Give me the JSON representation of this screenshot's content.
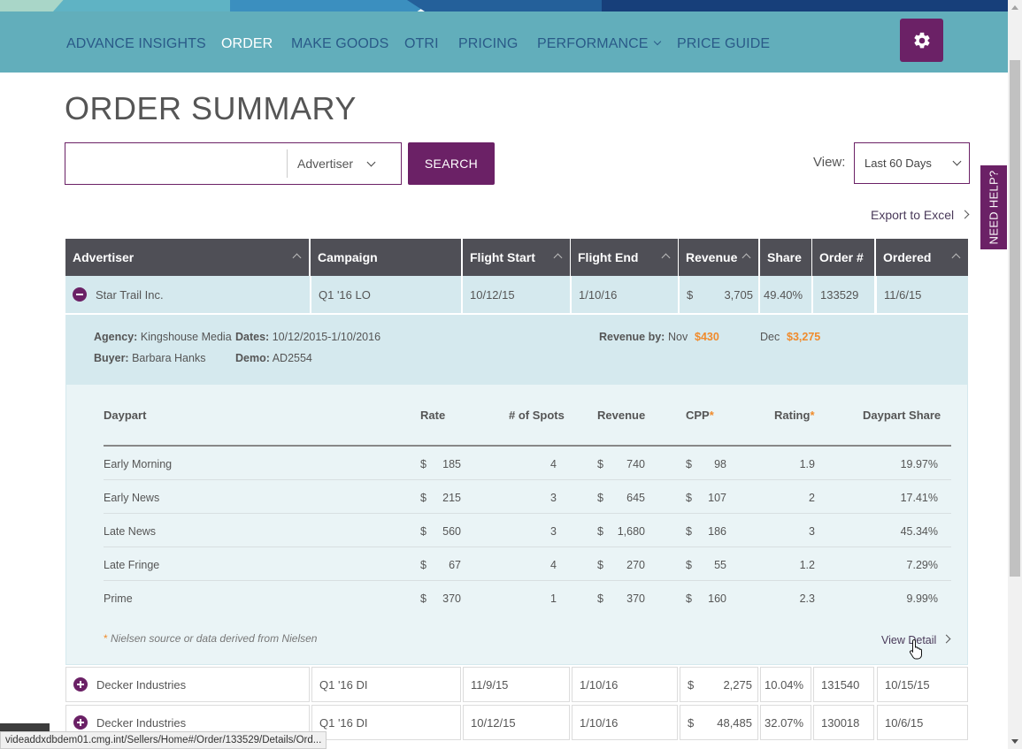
{
  "nav": {
    "items": [
      "ADVANCE INSIGHTS",
      "ORDER",
      "MAKE GOODS",
      "OTRI",
      "PRICING",
      "PERFORMANCE",
      "PRICE GUIDE"
    ],
    "active": "ORDER"
  },
  "title": "ORDER SUMMARY",
  "search": {
    "value": "",
    "select_value": "Advertiser",
    "button": "SEARCH"
  },
  "view": {
    "label": "View:",
    "value": "Last 60 Days"
  },
  "export_label": "Export to Excel",
  "need_help": "NEED HELP?",
  "table": {
    "headers": [
      "Advertiser",
      "Campaign",
      "Flight Start",
      "Flight End",
      "Revenue",
      "Share",
      "Order #",
      "Ordered"
    ],
    "rows": [
      {
        "advertiser": "Star Trail Inc.",
        "campaign": "Q1 '16 LO",
        "flight_start": "10/12/15",
        "flight_end": "1/10/16",
        "currency": "$",
        "revenue": "3,705",
        "share": "49.40%",
        "order": "133529",
        "ordered": "11/6/15"
      },
      {
        "advertiser": "Decker Industries",
        "campaign": "Q1 '16 DI",
        "flight_start": "11/9/15",
        "flight_end": "1/10/16",
        "currency": "$",
        "revenue": "2,275",
        "share": "10.04%",
        "order": "131540",
        "ordered": "10/15/15"
      },
      {
        "advertiser": "Decker Industries",
        "campaign": "Q1 '16 DI",
        "flight_start": "10/12/15",
        "flight_end": "1/10/16",
        "currency": "$",
        "revenue": "48,485",
        "share": "32.07%",
        "order": "130018",
        "ordered": "10/6/15"
      }
    ]
  },
  "detail": {
    "agency_label": "Agency:",
    "agency": "Kingshouse Media",
    "buyer_label": "Buyer:",
    "buyer": "Barbara Hanks",
    "dates_label": "Dates:",
    "dates": "10/12/2015-1/10/2016",
    "demo_label": "Demo:",
    "demo": "AD2554",
    "revenue_by_label": "Revenue by:",
    "rev_month_1": "Nov",
    "rev_value_1": "$430",
    "rev_month_2": "Dec",
    "rev_value_2": "$3,275",
    "headers": {
      "daypart": "Daypart",
      "rate": "Rate",
      "spots": "# of Spots",
      "revenue": "Revenue",
      "cpp": "CPP",
      "rating": "Rating",
      "share": "Daypart Share",
      "asterisk": "*"
    },
    "rows": [
      {
        "daypart": "Early Morning",
        "rate": "185",
        "spots": "4",
        "revenue": "740",
        "cpp": "98",
        "rating": "1.9",
        "share": "19.97%"
      },
      {
        "daypart": "Early News",
        "rate": "215",
        "spots": "3",
        "revenue": "645",
        "cpp": "107",
        "rating": "2",
        "share": "17.41%"
      },
      {
        "daypart": "Late News",
        "rate": "560",
        "spots": "3",
        "revenue": "1,680",
        "cpp": "186",
        "rating": "3",
        "share": "45.34%"
      },
      {
        "daypart": "Late Fringe",
        "rate": "67",
        "spots": "4",
        "revenue": "270",
        "cpp": "55",
        "rating": "1.2",
        "share": "7.29%"
      },
      {
        "daypart": "Prime",
        "rate": "370",
        "spots": "1",
        "revenue": "370",
        "cpp": "160",
        "rating": "2.3",
        "share": "9.99%"
      }
    ],
    "currency": "$",
    "footnote_star": "*",
    "footnote": "Nielsen source or data derived from Nielsen",
    "view_detail": "View Detail"
  },
  "status_url": "videaddxdbdem01.cmg.int/Sellers/Home#/Order/133529/Details/Ord...",
  "colors": {
    "nav_bg": "#62aebb",
    "accent_purple": "#6b2166",
    "header_bg": "#4f4f56",
    "orange": "#f08b2c"
  }
}
